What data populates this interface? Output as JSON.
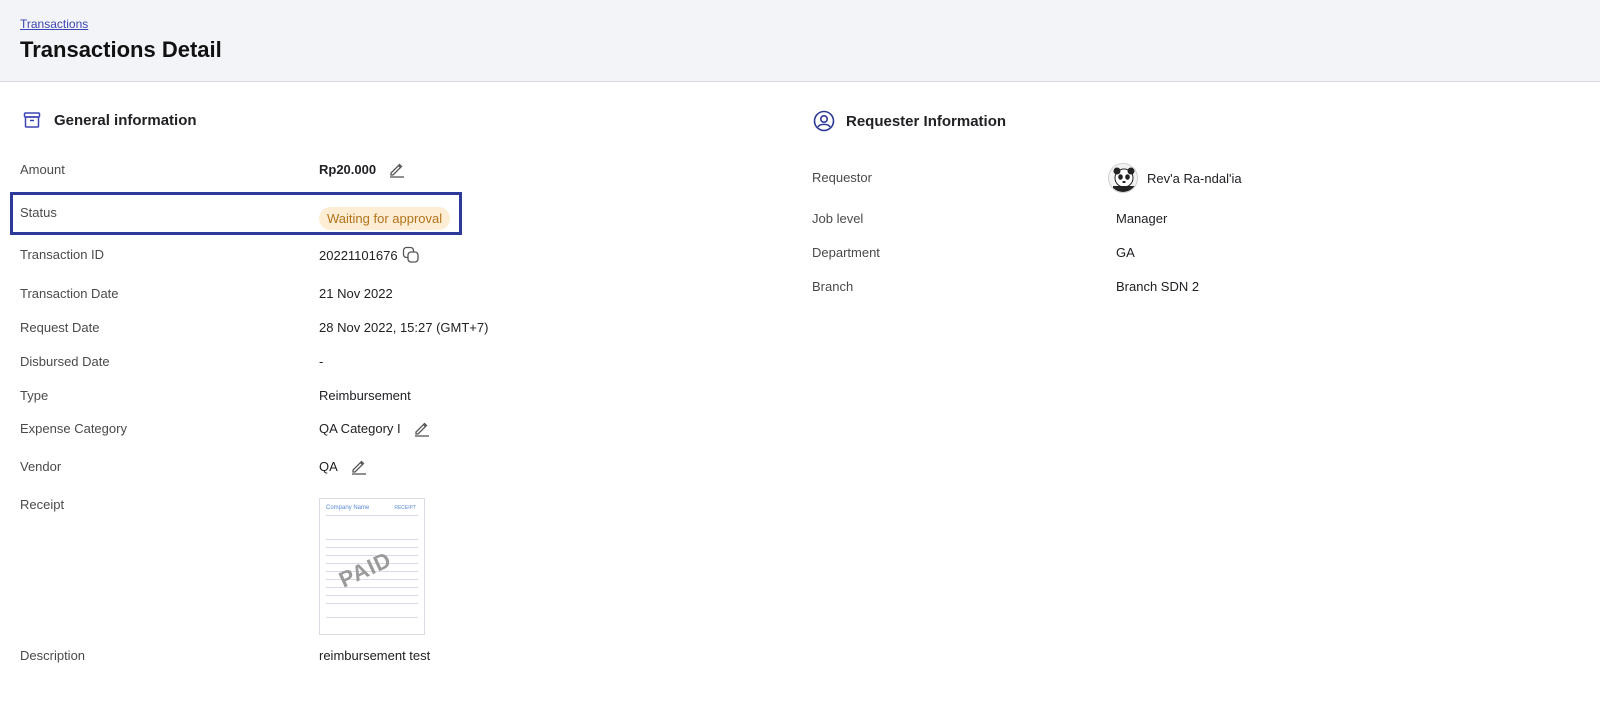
{
  "header": {
    "breadcrumb": "Transactions",
    "title": "Transactions Detail"
  },
  "general": {
    "section_title": "General information",
    "section_icon": "archive-box-icon",
    "fields": {
      "amount_label": "Amount",
      "amount_value": "Rp20.000",
      "status_label": "Status",
      "status_value": "Waiting for approval",
      "transaction_id_label": "Transaction ID",
      "transaction_id_value": "20221101676",
      "transaction_date_label": "Transaction Date",
      "transaction_date_value": "21 Nov 2022",
      "request_date_label": "Request Date",
      "request_date_value": "28 Nov 2022, 15:27 (GMT+7)",
      "disbursed_date_label": "Disbursed Date",
      "disbursed_date_value": "-",
      "type_label": "Type",
      "type_value": "Reimbursement",
      "expense_category_label": "Expense Category",
      "expense_category_value": "QA Category I",
      "vendor_label": "Vendor",
      "vendor_value": "QA",
      "receipt_label": "Receipt",
      "description_label": "Description",
      "description_value": "reimbursement test"
    },
    "receipt_image": {
      "company": "Company Name",
      "title": "RECEIPT",
      "stamp": "PAID"
    }
  },
  "requester": {
    "section_title": "Requester Information",
    "section_icon": "user-circle-icon",
    "fields": {
      "requestor_label": "Requestor",
      "requestor_value": "Rev'a Ra-ndal'ia",
      "job_level_label": "Job level",
      "job_level_value": "Manager",
      "department_label": "Department",
      "department_value": "GA",
      "branch_label": "Branch",
      "branch_value": "Branch SDN 2"
    }
  },
  "colors": {
    "accent": "#3b45b5",
    "status_bg": "#fdedd4",
    "status_text": "#b4731b",
    "highlight_border": "#2d3a9a"
  }
}
